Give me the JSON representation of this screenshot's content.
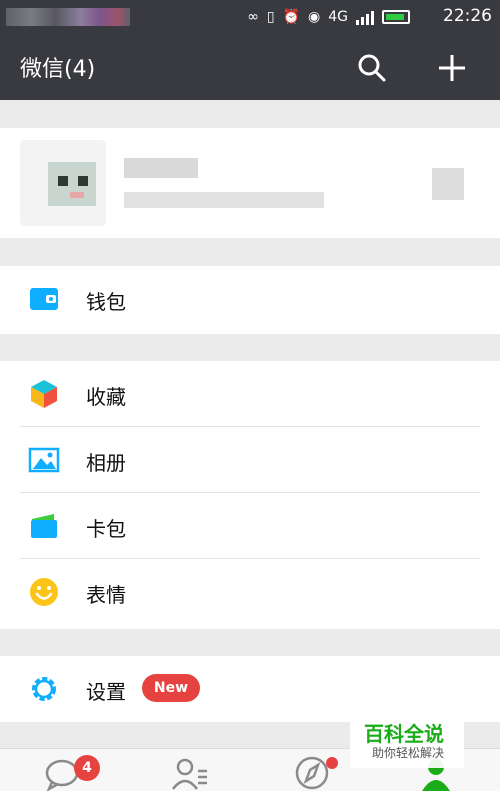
{
  "status_bar": {
    "network_labels": [
      "4G",
      "4G"
    ],
    "time": "22:26"
  },
  "header": {
    "title": "微信(4)",
    "icons": [
      "search-icon",
      "plus-icon"
    ]
  },
  "menu": {
    "wallet": {
      "label": "钱包",
      "icon": "wallet-icon"
    },
    "favorites": {
      "label": "收藏",
      "icon": "cube-icon"
    },
    "album": {
      "label": "相册",
      "icon": "image-icon"
    },
    "cards": {
      "label": "卡包",
      "icon": "card-icon"
    },
    "stickers": {
      "label": "表情",
      "icon": "smiley-icon"
    },
    "settings": {
      "label": "设置",
      "icon": "gear-icon",
      "badge": "New"
    }
  },
  "tab_bar": {
    "chats_badge": "4",
    "icons": [
      "chat-icon",
      "contacts-icon",
      "discover-icon",
      "me-icon"
    ]
  },
  "watermark": {
    "title": "百科全说",
    "subtitle": "助你轻松解决"
  },
  "colors": {
    "header_bg": "#393a3f",
    "accent_blue": "#10aeff",
    "badge_red": "#e64340",
    "active_green": "#1aad19"
  }
}
